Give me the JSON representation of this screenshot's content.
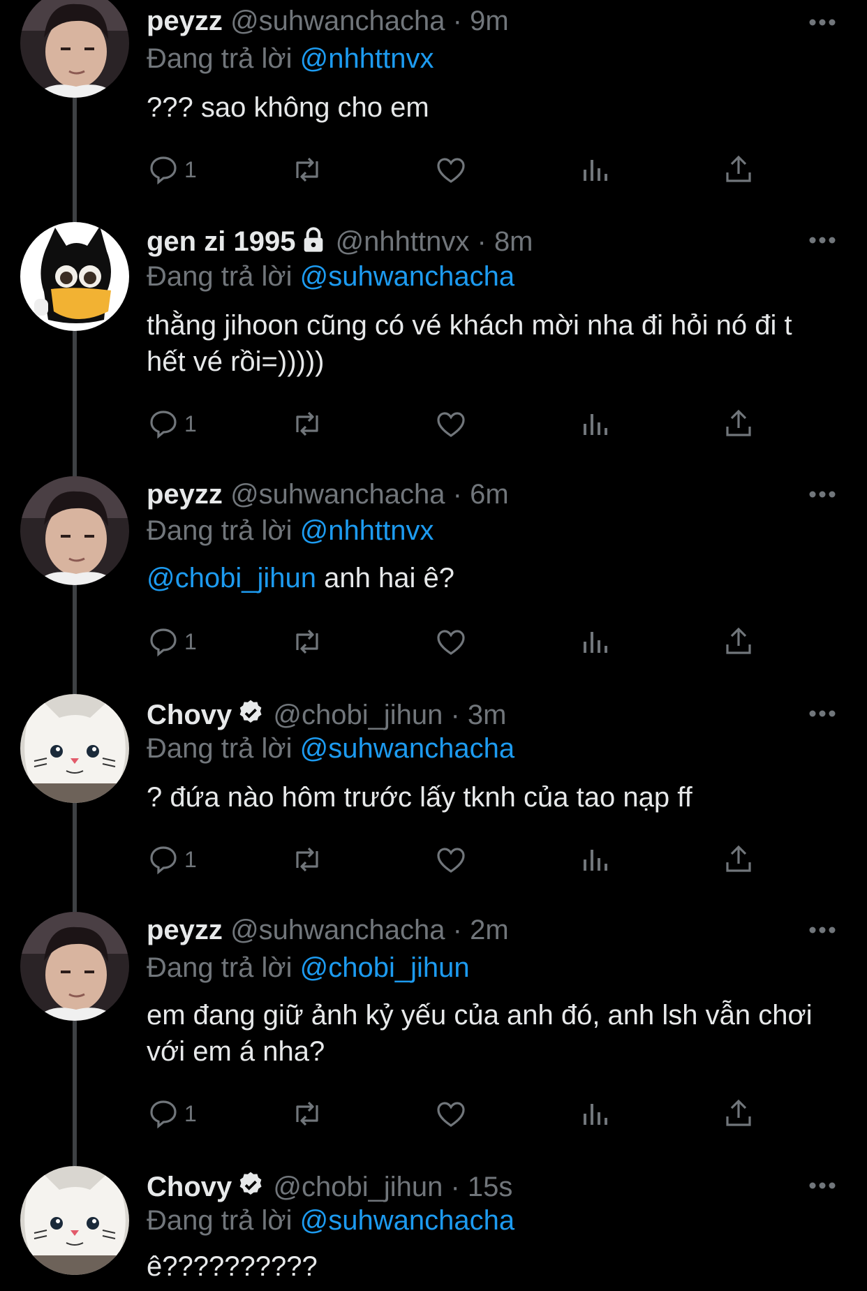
{
  "tweets": [
    {
      "name": "peyzz",
      "handle": "@suhwanchacha",
      "sep": " · ",
      "time": "9m",
      "reply_prefix": "Đang trả lời ",
      "reply_to": "@nhhttnvx",
      "text": "??? sao không cho em",
      "mention": "",
      "reply_count": "1",
      "avatar": "photo-avatar"
    },
    {
      "name": "gen zi 1995",
      "handle": "@nhhttnvx",
      "sep": " · ",
      "time": "8m",
      "reply_prefix": "Đang trả lời ",
      "reply_to": "@suhwanchacha",
      "text": "thằng jihoon cũng có vé khách mời nha đi hỏi nó đi t hết vé rồi=)))))",
      "mention": "",
      "reply_count": "1",
      "avatar": "cartoon-avatar",
      "badge": "lock-icon"
    },
    {
      "name": "peyzz",
      "handle": "@suhwanchacha",
      "sep": " · ",
      "time": "6m",
      "reply_prefix": "Đang trả lời ",
      "reply_to": "@nhhttnvx",
      "mention": "@chobi_jihun",
      "text": " anh hai ê?",
      "reply_count": "1",
      "avatar": "photo-avatar"
    },
    {
      "name": "Chovy",
      "handle": "@chobi_jihun",
      "sep": " · ",
      "time": "3m",
      "reply_prefix": "Đang trả lời ",
      "reply_to": "@suhwanchacha",
      "text": "? đứa nào hôm trước lấy tknh của tao nạp ff",
      "mention": "",
      "reply_count": "1",
      "avatar": "cat-avatar",
      "badge": "verified-icon"
    },
    {
      "name": "peyzz",
      "handle": "@suhwanchacha",
      "sep": " · ",
      "time": "2m",
      "reply_prefix": "Đang trả lời ",
      "reply_to": "@chobi_jihun",
      "text": "em đang giữ ảnh kỷ yếu của anh đó, anh lsh vẫn chơi với em á nha?",
      "mention": "",
      "reply_count": "1",
      "avatar": "photo-avatar"
    },
    {
      "name": "Chovy",
      "handle": "@chobi_jihun",
      "sep": " · ",
      "time": "15s",
      "reply_prefix": "Đang trả lời ",
      "reply_to": "@suhwanchacha",
      "text": "ê??????????",
      "mention": "",
      "reply_count": "",
      "avatar": "cat-avatar",
      "badge": "verified-icon"
    }
  ],
  "colors": {
    "background": "#000000",
    "text": "#e7e9ea",
    "muted": "#71767b",
    "link": "#1d9bf0",
    "thread_line": "#3e4144"
  },
  "icons": [
    "reply-icon",
    "retweet-icon",
    "like-icon",
    "views-icon",
    "share-icon",
    "more-icon",
    "verified-icon",
    "lock-icon"
  ]
}
